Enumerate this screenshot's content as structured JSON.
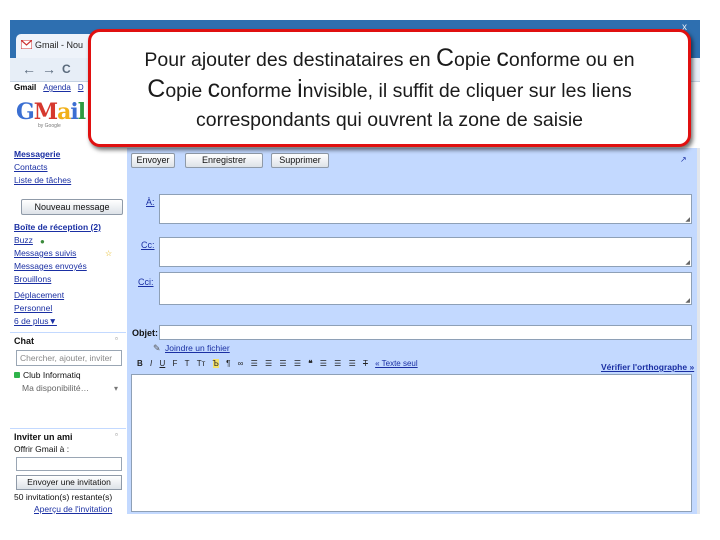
{
  "browser": {
    "tab_title": "Gmail - Nou",
    "window_close": "x",
    "nav_back": "←",
    "nav_forward": "→",
    "nav_reload": "C"
  },
  "gbar": {
    "items": [
      "Gmail",
      "Agenda",
      "D"
    ]
  },
  "logo": {
    "g1": "G",
    "g2": "M",
    "g3": "a",
    "g4": "i",
    "g5": "l",
    "sub": "by Google"
  },
  "leftnav": {
    "items": [
      "Messagerie",
      "Contacts",
      "Liste de tâches"
    ],
    "compose_label": "Nouveau message",
    "folders": [
      "Boîte de réception (2)",
      "Buzz",
      "Messages suivis",
      "Messages envoyés",
      "Brouillons",
      "Déplacement",
      "Personnel",
      "6 de plus▼"
    ]
  },
  "chat": {
    "heading": "Chat",
    "search_placeholder": "Chercher, ajouter, inviter",
    "contact": "Club Informatiq",
    "availability": "Ma disponibilité…"
  },
  "invite": {
    "heading": "Inviter un ami",
    "offer_label": "Offrir Gmail à :",
    "button_label": "Envoyer une invitation",
    "remaining": "50 invitation(s) restante(s)",
    "preview_link": "Aperçu de l'invitation"
  },
  "compose": {
    "send_label": "Envoyer",
    "save_label": "Enregistrer",
    "delete_label": "Supprimer",
    "to_label": "À:",
    "cc_label": "Cc:",
    "bcc_label": "Cci:",
    "subject_label": "Objet:",
    "attach_label": "Joindre un fichier",
    "plain_text_link": "« Texte seul",
    "spellcheck_label": "Vérifier l'orthographe »",
    "toolbar_glyphs": [
      "B",
      "I",
      "U",
      "F",
      "T",
      "Tт",
      "Ъ",
      "¶",
      "∞",
      "☰",
      "☰",
      "☰",
      "☰",
      "❝",
      "☰",
      "☰",
      "☰",
      "T"
    ]
  },
  "callout": {
    "line1_a": "Pour ajouter des destinataires en ",
    "line1_b": "C",
    "line1_c": "opie ",
    "line1_d": "c",
    "line1_e": "onforme ou en",
    "line2_a": "C",
    "line2_b": "opie ",
    "line2_c": "c",
    "line2_d": "onforme ",
    "line2_e": "i",
    "line2_f": "nvisible, il suffit de cliquer sur les liens",
    "line3": "correspondants qui ouvrent la zone de saisie"
  }
}
